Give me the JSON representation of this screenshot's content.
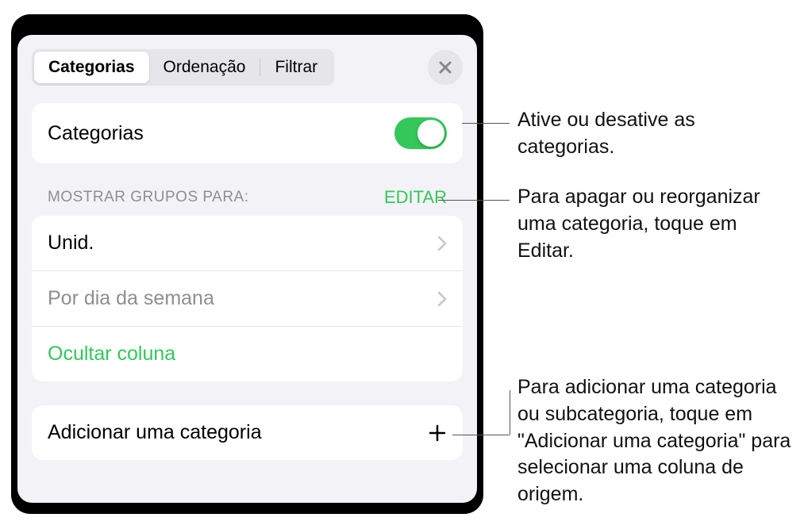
{
  "tabs": {
    "categories": "Categorias",
    "sorting": "Ordenação",
    "filter": "Filtrar"
  },
  "categories_toggle": {
    "label": "Categorias"
  },
  "groups_section": {
    "title": "MOSTRAR GRUPOS PARA:",
    "edit": "EDITAR"
  },
  "group_items": {
    "unit": "Unid.",
    "weekday": "Por dia da semana",
    "hide_column": "Ocultar coluna"
  },
  "add_category": {
    "label": "Adicionar uma categoria"
  },
  "callouts": {
    "toggle": "Ative ou desative as categorias.",
    "edit": "Para apagar ou reorganizar uma categoria, toque em Editar.",
    "add": "Para adicionar uma categoria ou subcategoria, toque em \"Adicionar uma categoria\" para selecionar uma coluna de origem."
  }
}
